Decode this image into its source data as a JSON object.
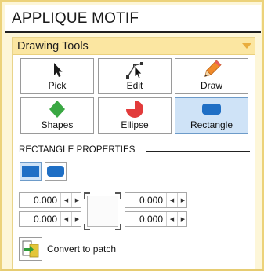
{
  "panel": {
    "title": "APPLIQUE MOTIF"
  },
  "section": {
    "title": "Drawing Tools"
  },
  "tools": [
    {
      "label": "Pick",
      "icon": "pick-arrow-icon",
      "active": false
    },
    {
      "label": "Edit",
      "icon": "edit-node-icon",
      "active": false
    },
    {
      "label": "Draw",
      "icon": "pencil-icon",
      "active": false
    },
    {
      "label": "Shapes",
      "icon": "diamond-icon",
      "active": false
    },
    {
      "label": "Ellipse",
      "icon": "ellipse-icon",
      "active": false
    },
    {
      "label": "Rectangle",
      "icon": "rectangle-icon",
      "active": true
    }
  ],
  "properties": {
    "title": "RECTANGLE PROPERTIES",
    "shape_options": [
      "square-corner-rectangle-icon",
      "rounded-rectangle-icon"
    ],
    "corner_values": {
      "top_left": "0.000",
      "top_right": "0.000",
      "bottom_left": "0.000",
      "bottom_right": "0.000"
    }
  },
  "convert": {
    "label": "Convert to patch",
    "icon": "convert-to-patch-icon"
  },
  "colors": {
    "accent_blue": "#1f6fc5",
    "active_bg": "#cfe3f7",
    "diamond_green": "#3aa843",
    "ellipse_red": "#e23b3b",
    "pencil_orange": "#f08a2a",
    "header_yellow": "#fbe6a1"
  }
}
